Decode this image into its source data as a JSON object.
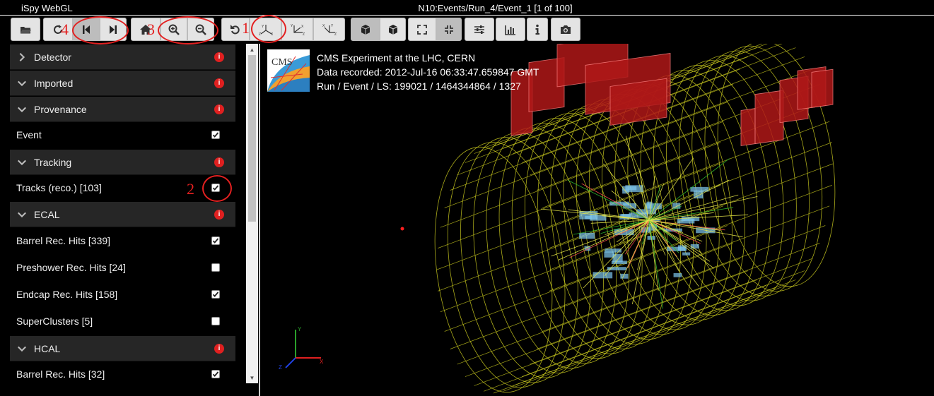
{
  "app": {
    "name": "iSpy WebGL"
  },
  "event": {
    "title": "N10:Events/Run_4/Event_1 [1 of 100]"
  },
  "toolbar": {
    "buttons": [
      {
        "id": "open",
        "icon": "folder-open-icon"
      },
      {
        "id": "reload",
        "icon": "reload-icon"
      },
      {
        "id": "prev",
        "icon": "step-backward-icon"
      },
      {
        "id": "next",
        "icon": "step-forward-icon"
      },
      {
        "id": "home",
        "icon": "home-icon"
      },
      {
        "id": "zoom-in",
        "icon": "zoom-in-icon"
      },
      {
        "id": "zoom-out",
        "icon": "zoom-out-icon"
      },
      {
        "id": "reset",
        "icon": "undo-icon"
      },
      {
        "id": "view-3d",
        "icon": "axes-3d-icon"
      },
      {
        "id": "view-rz",
        "icon": "axes-rz-icon"
      },
      {
        "id": "view-xy",
        "icon": "axes-xy-icon"
      },
      {
        "id": "perspective",
        "icon": "cube-perspective-icon"
      },
      {
        "id": "ortho",
        "icon": "cube-ortho-icon"
      },
      {
        "id": "fullscreen",
        "icon": "expand-icon"
      },
      {
        "id": "compress",
        "icon": "compress-icon"
      },
      {
        "id": "controls",
        "icon": "sliders-icon"
      },
      {
        "id": "tables",
        "icon": "bar-chart-icon"
      },
      {
        "id": "info",
        "icon": "info-icon"
      },
      {
        "id": "snapshot",
        "icon": "camera-icon"
      }
    ]
  },
  "sidebar": {
    "items": [
      {
        "type": "section",
        "label": "Detector",
        "expanded": false
      },
      {
        "type": "section",
        "label": "Imported",
        "expanded": true
      },
      {
        "type": "section",
        "label": "Provenance",
        "expanded": true
      },
      {
        "type": "item",
        "label": "Event",
        "checked": true
      },
      {
        "type": "section",
        "label": "Tracking",
        "expanded": true
      },
      {
        "type": "item",
        "label": "Tracks (reco.) [103]",
        "checked": true
      },
      {
        "type": "section",
        "label": "ECAL",
        "expanded": true
      },
      {
        "type": "item",
        "label": "Barrel Rec. Hits [339]",
        "checked": true
      },
      {
        "type": "item",
        "label": "Preshower Rec. Hits [24]",
        "checked": false
      },
      {
        "type": "item",
        "label": "Endcap Rec. Hits [158]",
        "checked": true
      },
      {
        "type": "item",
        "label": "SuperClusters [5]",
        "checked": false
      },
      {
        "type": "section",
        "label": "HCAL",
        "expanded": true
      },
      {
        "type": "item",
        "label": "Barrel Rec. Hits [32]",
        "checked": true
      }
    ]
  },
  "viewer": {
    "info": {
      "line1": "CMS Experiment at the LHC, CERN",
      "line2": "Data recorded: 2012-Jul-16 06:33:47.659847 GMT",
      "line3": "Run / Event / LS: 199021 / 1464344864 / 1327"
    },
    "logo_text": "CMS",
    "axes": {
      "x": "X",
      "y": "Y",
      "z": "Z"
    }
  },
  "annotations": {
    "a1": "1",
    "a2": "2",
    "a3": "3",
    "a4": "4"
  },
  "colors": {
    "accent": "#e32020",
    "wire": "#c8c81e",
    "calo": "#b01818",
    "hits": "#7fc7f0",
    "track": "#e8e84a"
  }
}
